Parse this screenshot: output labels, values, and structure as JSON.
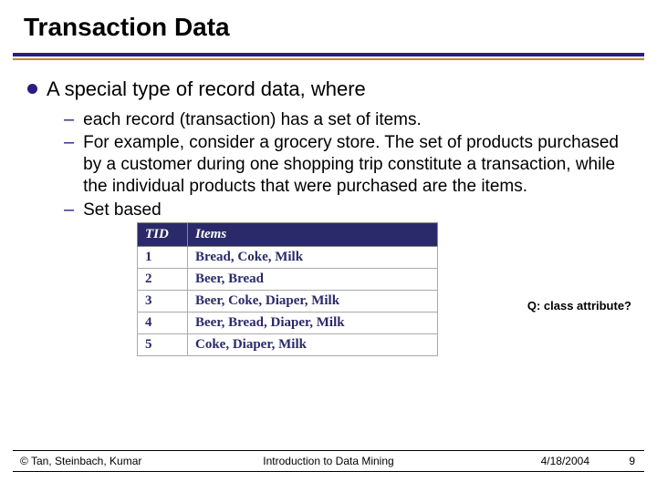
{
  "title": "Transaction Data",
  "bullet": "A special type of record data, where",
  "subs": [
    "each record (transaction) has a set of items.",
    "For example, consider a grocery store.  The set of products purchased by a customer during one shopping trip constitute a transaction, while the individual products that were purchased are the items.",
    "Set based"
  ],
  "question": "Q: class attribute?",
  "table": {
    "headers": [
      "TID",
      "Items"
    ],
    "rows": [
      {
        "tid": "1",
        "items": "Bread, Coke, Milk"
      },
      {
        "tid": "2",
        "items": "Beer, Bread"
      },
      {
        "tid": "3",
        "items": "Beer, Coke, Diaper, Milk"
      },
      {
        "tid": "4",
        "items": "Beer, Bread, Diaper, Milk"
      },
      {
        "tid": "5",
        "items": "Coke, Diaper, Milk"
      }
    ]
  },
  "footer": {
    "copyright": "© Tan, Steinbach, Kumar",
    "center": "Introduction to Data Mining",
    "date": "4/18/2004",
    "page": "9"
  }
}
